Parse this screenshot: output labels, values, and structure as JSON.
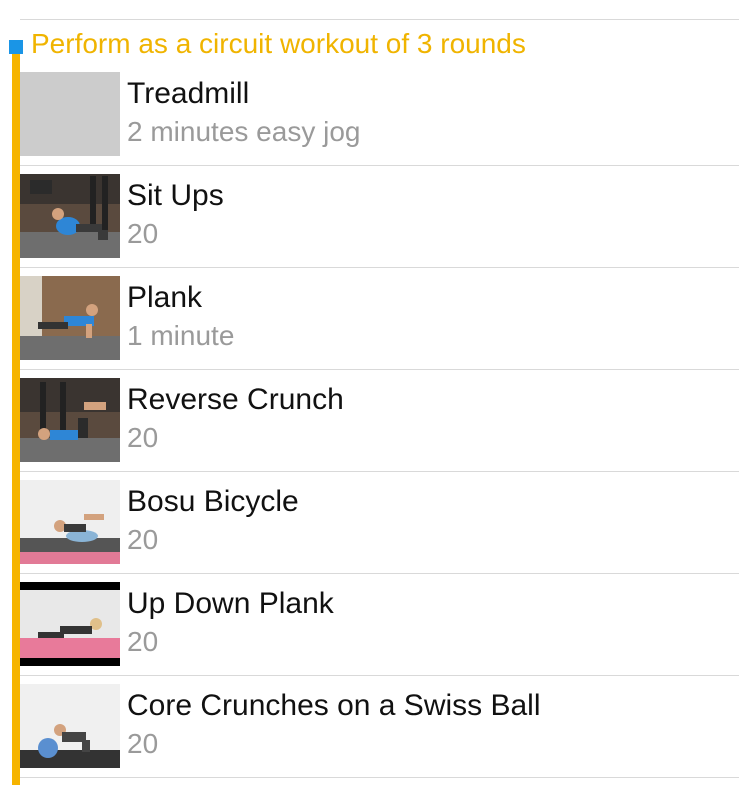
{
  "circuit": {
    "title": "Perform as a circuit workout of 3 rounds",
    "colors": {
      "rail": "#f6b400",
      "title": "#f0b400",
      "marker": "#1a95e6"
    }
  },
  "exercises": [
    {
      "name": "Treadmill",
      "detail": "2 minutes easy jog",
      "thumbnail": "placeholder-gray"
    },
    {
      "name": "Sit Ups",
      "detail": "20",
      "thumbnail": "gym-situp-photo"
    },
    {
      "name": "Plank",
      "detail": "1 minute",
      "thumbnail": "gym-plank-photo"
    },
    {
      "name": "Reverse Crunch",
      "detail": "20",
      "thumbnail": "gym-reverse-crunch-photo"
    },
    {
      "name": "Bosu Bicycle",
      "detail": "20",
      "thumbnail": "studio-bosu-photo"
    },
    {
      "name": "Up Down Plank",
      "detail": "20",
      "thumbnail": "studio-plank-photo"
    },
    {
      "name": "Core Crunches on a Swiss Ball",
      "detail": "20",
      "thumbnail": "studio-swissball-photo"
    }
  ]
}
